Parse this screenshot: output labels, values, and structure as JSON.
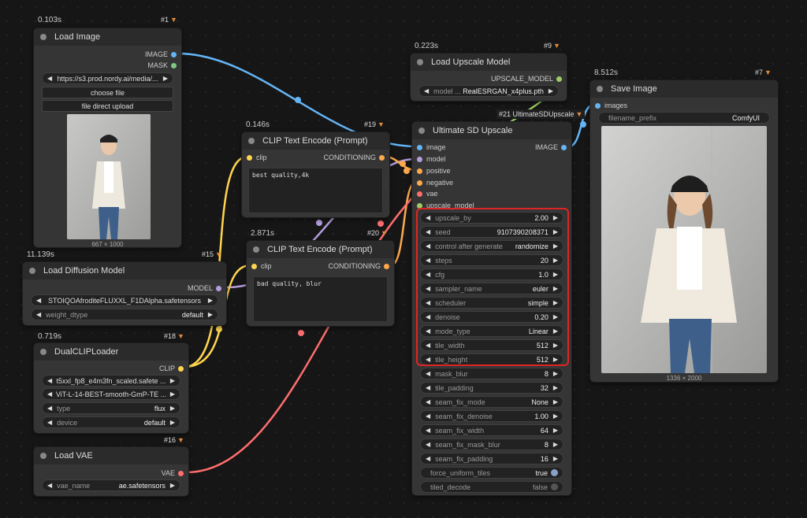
{
  "nodes": {
    "load_image": {
      "timing": "0.103s",
      "badge": "#1",
      "title": "Load Image",
      "outputs": [
        "IMAGE",
        "MASK"
      ],
      "url_value": "https://s3.prod.nordy.ai/media/...",
      "choose_file": "choose file",
      "direct_upload": "file direct upload",
      "dims": "667 × 1000"
    },
    "upscale_model": {
      "timing": "0.223s",
      "badge": "#9",
      "title": "Load Upscale Model",
      "output": "UPSCALE_MODEL",
      "model_label": "model ...",
      "model_value": "RealESRGAN_x4plus.pth"
    },
    "save_image": {
      "timing": "8.512s",
      "badge": "#7",
      "title": "Save Image",
      "input": "images",
      "prefix_label": "filename_prefix",
      "prefix_value": "ComfyUI",
      "dims": "1336 × 2000"
    },
    "clip_pos": {
      "timing": "0.146s",
      "badge": "#19",
      "title": "CLIP Text Encode (Prompt)",
      "input": "clip",
      "output": "CONDITIONING",
      "text": "best quality,4k"
    },
    "clip_neg": {
      "timing": "2.871s",
      "badge": "#20",
      "title": "CLIP Text Encode (Prompt)",
      "input": "clip",
      "output": "CONDITIONING",
      "text": "bad quality, blur"
    },
    "diffusion": {
      "timing": "11.139s",
      "badge": "#15",
      "title": "Load Diffusion Model",
      "output": "MODEL",
      "unet_value": "STOIQOAfroditeFLUXXL_F1DAlpha.safetensors",
      "dtype_label": "weight_dtype",
      "dtype_value": "default"
    },
    "dualclip": {
      "timing": "0.719s",
      "badge": "#18",
      "title": "DualCLIPLoader",
      "output": "CLIP",
      "clip1": "t5xxl_fp8_e4m3fn_scaled.safete ...",
      "clip2": "ViT-L-14-BEST-smooth-GmP-TE ...",
      "type_label": "type",
      "type_value": "flux",
      "device_label": "device",
      "device_value": "default"
    },
    "vae": {
      "badge": "#16",
      "title": "Load VAE",
      "output": "VAE",
      "vae_label": "vae_name",
      "vae_value": "ae.safetensors"
    },
    "ultimate": {
      "badge": "#21 UltimateSDUpscale",
      "title": "Ultimate SD Upscale",
      "inputs": [
        "image",
        "model",
        "positive",
        "negative",
        "vae",
        "upscale_model"
      ],
      "output": "IMAGE",
      "widgets": [
        {
          "label": "upscale_by",
          "value": "2.00"
        },
        {
          "label": "seed",
          "value": "9107390208371"
        },
        {
          "label": "control after generate",
          "value": "randomize"
        },
        {
          "label": "steps",
          "value": "20"
        },
        {
          "label": "cfg",
          "value": "1.0"
        },
        {
          "label": "sampler_name",
          "value": "euler"
        },
        {
          "label": "scheduler",
          "value": "simple"
        },
        {
          "label": "denoise",
          "value": "0.20"
        },
        {
          "label": "mode_type",
          "value": "Linear"
        },
        {
          "label": "tile_width",
          "value": "512"
        },
        {
          "label": "tile_height",
          "value": "512"
        },
        {
          "label": "mask_blur",
          "value": "8"
        },
        {
          "label": "tile_padding",
          "value": "32"
        },
        {
          "label": "seam_fix_mode",
          "value": "None"
        },
        {
          "label": "seam_fix_denoise",
          "value": "1.00"
        },
        {
          "label": "seam_fix_width",
          "value": "64"
        },
        {
          "label": "seam_fix_mask_blur",
          "value": "8"
        },
        {
          "label": "seam_fix_padding",
          "value": "16"
        }
      ],
      "toggles": [
        {
          "label": "force_uniform_tiles",
          "value": "true"
        },
        {
          "label": "tiled_decode",
          "value": "false"
        }
      ]
    }
  },
  "colors": {
    "image": "#64b5f6",
    "mask": "#81c784",
    "model": "#b39ddb",
    "clip": "#ffd54f",
    "conditioning": "#ffa94d",
    "vae": "#ff6e6e",
    "upscale_model": "#9ccc65",
    "highlight": "#e02424"
  },
  "icons": [
    "fox-badge-icon",
    "arrow-left-icon",
    "arrow-right-icon"
  ]
}
